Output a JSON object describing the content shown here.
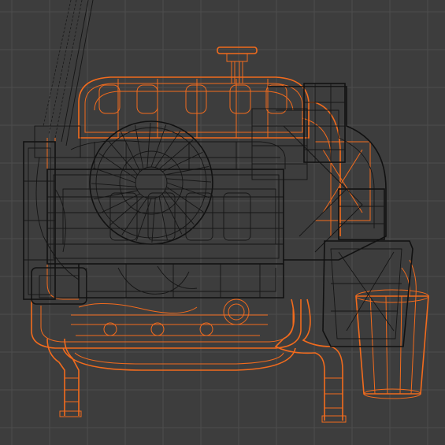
{
  "viewport": {
    "mode": "wireframe",
    "object": "engine",
    "colors": {
      "background": "#3d3d3d",
      "grid": "#4d4d4d",
      "selected_wire": "#f26b1d",
      "unselected_wire": "#151515"
    }
  }
}
